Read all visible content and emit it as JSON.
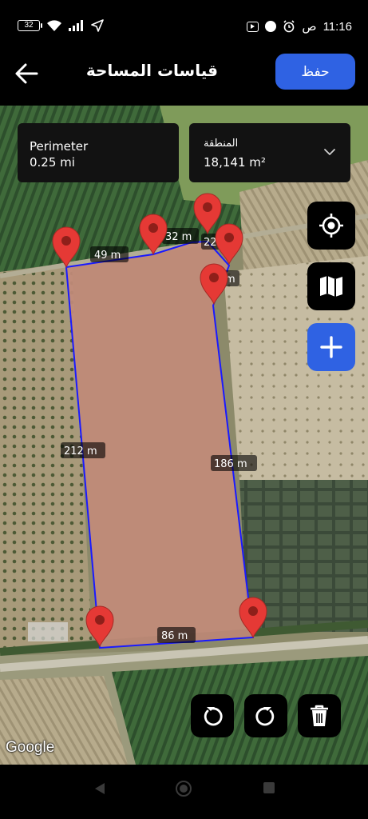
{
  "status_bar": {
    "battery": "32",
    "time": "11:16",
    "period": "ص"
  },
  "app_bar": {
    "title": "قياسات المساحة",
    "save_label": "حفظ"
  },
  "perimeter_card": {
    "label": "Perimeter",
    "value": "0.25 mi"
  },
  "area_card": {
    "label": "المنطقة",
    "value": "18,141 m²"
  },
  "map": {
    "segments": {
      "top_left": "49 m",
      "top_mid": "32 m",
      "top_right": "22",
      "right_short": "m",
      "left": "212 m",
      "right": "186 m",
      "bottom": "86 m"
    },
    "polygon_fill": "#c28b79",
    "outline_color": "#1a1aff",
    "marker_color": "#e53935",
    "attribution": "Google"
  },
  "colors": {
    "accent": "#2f62e3",
    "card_bg": "#121212"
  },
  "icons": {
    "locate": "crosshair-icon",
    "map_type": "map-icon",
    "add": "plus-icon",
    "undo": "undo-icon",
    "redo": "redo-icon",
    "delete": "trash-icon"
  }
}
